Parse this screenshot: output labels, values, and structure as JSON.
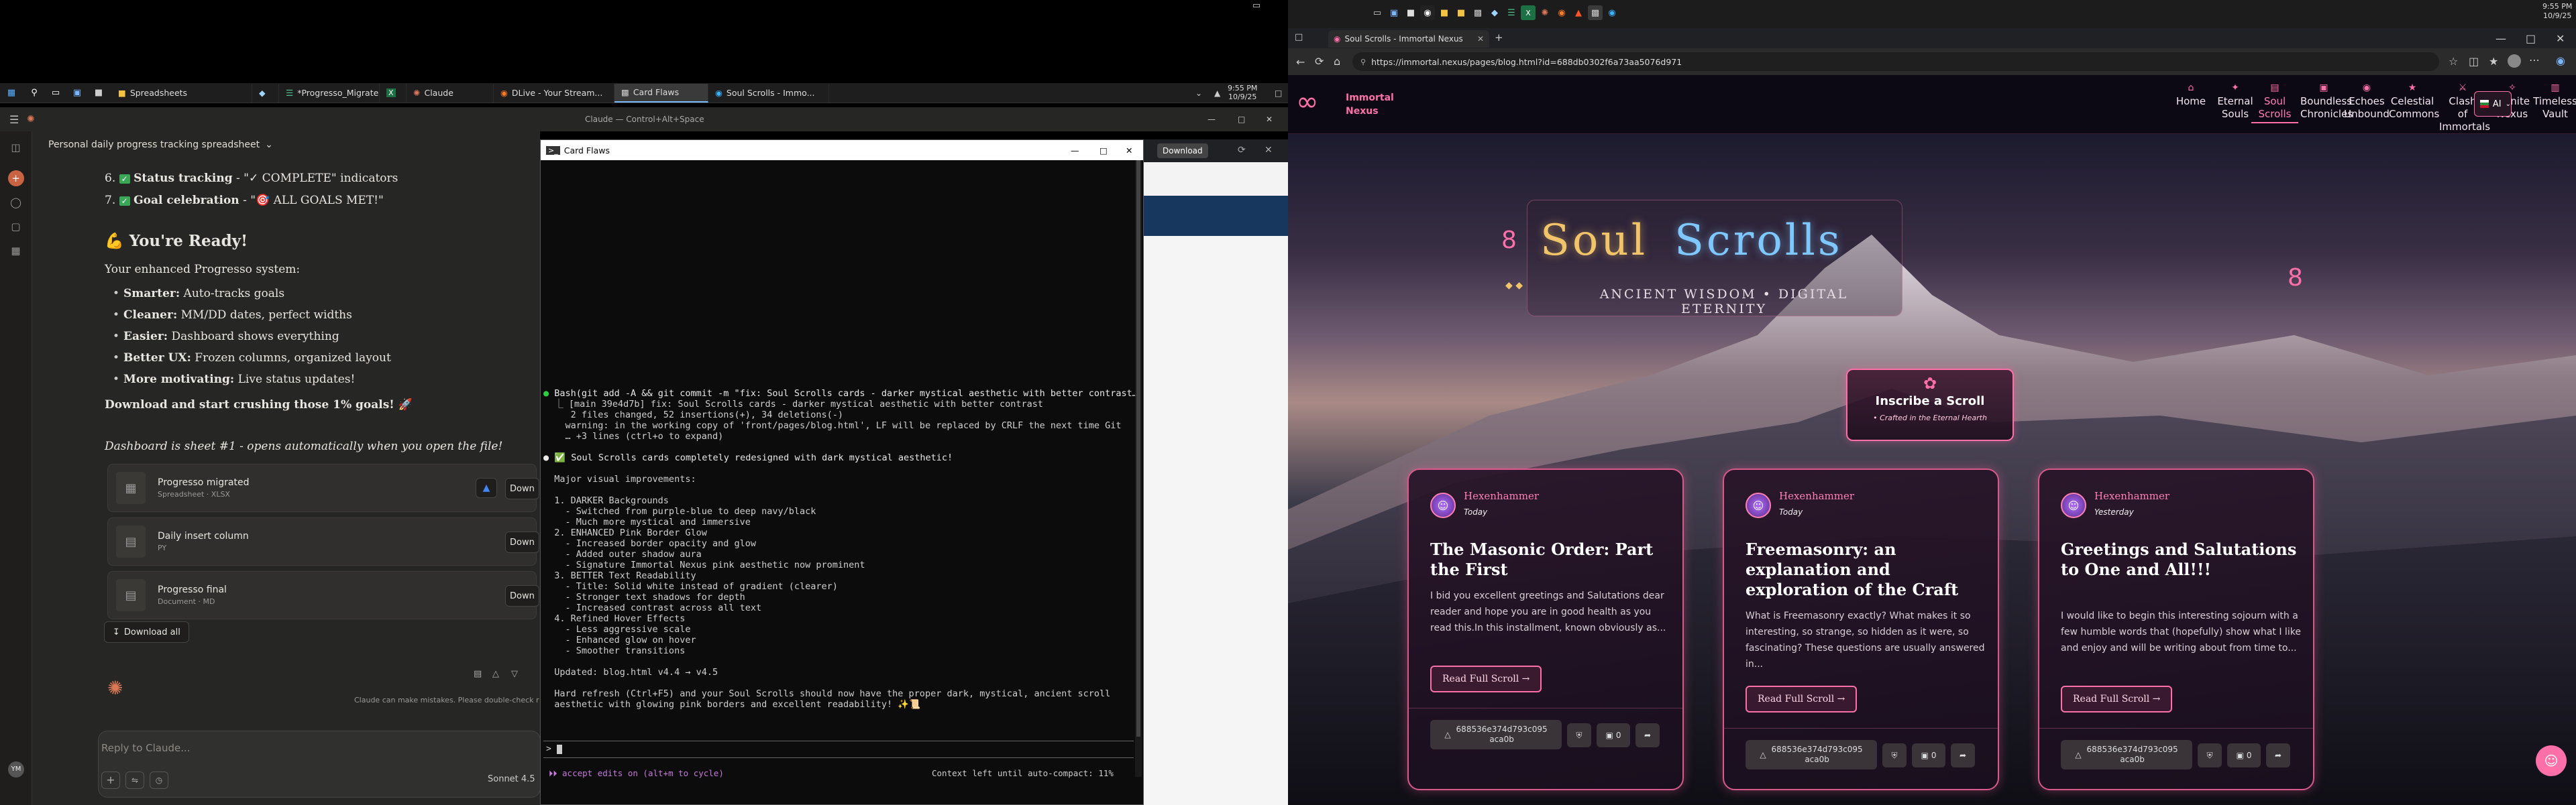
{
  "left_taskbar": {
    "clock_time": "9:55 PM",
    "clock_date": "10/9/25",
    "tabs": [
      {
        "label": "Spreadsheets"
      },
      {
        "label": "*Progresso_Migrate..."
      },
      {
        "label": "Claude"
      },
      {
        "label": "DLive - Your Stream..."
      },
      {
        "label": "Card Flaws"
      },
      {
        "label": "Soul Scrolls - Immo..."
      }
    ]
  },
  "claude": {
    "window_title": "Claude — Control+Alt+Space",
    "chat_title": "Personal daily progress tracking spreadsheet",
    "list_items": [
      {
        "num": "6.",
        "bold": "Status tracking",
        "rest": " - \"✓ COMPLETE\" indicators"
      },
      {
        "num": "7.",
        "bold": "Goal celebration",
        "rest": " - \"🎯 ALL GOALS MET!\""
      }
    ],
    "ready_heading": "💪 You're Ready!",
    "ready_intro": "Your enhanced Progresso system:",
    "bullets": [
      {
        "bold": "Smarter:",
        "rest": " Auto-tracks goals"
      },
      {
        "bold": "Cleaner:",
        "rest": " MM/DD dates, perfect widths"
      },
      {
        "bold": "Easier:",
        "rest": " Dashboard shows everything"
      },
      {
        "bold": "Better UX:",
        "rest": " Frozen columns, organized layout"
      },
      {
        "bold": "More motivating:",
        "rest": " Live status updates!"
      }
    ],
    "cta": "Download and start crushing those 1% goals! 🚀",
    "note": "Dashboard is sheet #1 - opens automatically when you open the file!",
    "files": [
      {
        "name": "Progresso migrated",
        "type": "Spreadsheet · XLSX",
        "action": "Down"
      },
      {
        "name": "Daily insert column",
        "type": "PY",
        "action": "Down"
      },
      {
        "name": "Progresso final",
        "type": "Document · MD",
        "action": "Down"
      }
    ],
    "download_all": "Download all",
    "disclaimer": "Claude can make mistakes. Please double-check r",
    "reply_placeholder": "Reply to Claude...",
    "model": "Sonnet 4.5",
    "user_initials": "YM"
  },
  "terminal": {
    "title": "Card Flaws",
    "lines": [
      {
        "t": "● Bash(git add -A && git commit -m \"fix: Soul Scrolls cards - darker mystical aesthetic with better contrast…",
        "c": "#e8e8e8",
        "dot": "#2ecc40"
      },
      {
        "t": "  ⎿ [main 39e4d7b] fix: Soul Scrolls cards - darker mystical aesthetic with better contrast",
        "c": "#cfcfcf"
      },
      {
        "t": "     2 files changed, 52 insertions(+), 34 deletions(-)",
        "c": "#cfcfcf"
      },
      {
        "t": "    warning: in the working copy of 'front/pages/blog.html', LF will be replaced by CRLF the next time Git",
        "c": "#cfcfcf"
      },
      {
        "t": "    … +3 lines (ctrl+o to expand)",
        "c": "#cfcfcf"
      },
      {
        "t": "",
        "c": "#cfcfcf"
      },
      {
        "t": "● ✅ Soul Scrolls cards completely redesigned with dark mystical aesthetic!",
        "c": "#e8e8e8",
        "dot": "#e8e8e8"
      },
      {
        "t": "",
        "c": "#cfcfcf"
      },
      {
        "t": "  Major visual improvements:",
        "c": "#cfcfcf"
      },
      {
        "t": "",
        "c": "#cfcfcf"
      },
      {
        "t": "  1. DARKER Backgrounds",
        "c": "#cfcfcf"
      },
      {
        "t": "    - Switched from purple-blue to deep navy/black",
        "c": "#cfcfcf"
      },
      {
        "t": "    - Much more mystical and immersive",
        "c": "#cfcfcf"
      },
      {
        "t": "  2. ENHANCED Pink Border Glow",
        "c": "#cfcfcf"
      },
      {
        "t": "    - Increased border opacity and glow",
        "c": "#cfcfcf"
      },
      {
        "t": "    - Added outer shadow aura",
        "c": "#cfcfcf"
      },
      {
        "t": "    - Signature Immortal Nexus pink aesthetic now prominent",
        "c": "#cfcfcf"
      },
      {
        "t": "  3. BETTER Text Readability",
        "c": "#cfcfcf"
      },
      {
        "t": "    - Title: Solid white instead of gradient (clearer)",
        "c": "#cfcfcf"
      },
      {
        "t": "    - Stronger text shadows for depth",
        "c": "#cfcfcf"
      },
      {
        "t": "    - Increased contrast across all text",
        "c": "#cfcfcf"
      },
      {
        "t": "  4. Refined Hover Effects",
        "c": "#cfcfcf"
      },
      {
        "t": "    - Less aggressive scale",
        "c": "#cfcfcf"
      },
      {
        "t": "    - Enhanced glow on hover",
        "c": "#cfcfcf"
      },
      {
        "t": "    - Smoother transitions",
        "c": "#cfcfcf"
      },
      {
        "t": "",
        "c": "#cfcfcf"
      },
      {
        "t": "  Updated: blog.html v4.4 → v4.5",
        "c": "#cfcfcf"
      },
      {
        "t": "",
        "c": "#cfcfcf"
      },
      {
        "t": "  Hard refresh (Ctrl+F5) and your Soul Scrolls should now have the proper dark, mystical, ancient scroll",
        "c": "#cfcfcf"
      },
      {
        "t": "  aesthetic with glowing pink borders and excellent readability! ✨📜",
        "c": "#cfcfcf"
      }
    ],
    "prompt": ">",
    "mode_hint": "⏵⏵ accept edits on (alt+m to cycle)",
    "context_hint": "Context left until auto-compact: 11%"
  },
  "bg_window": {
    "download_label": "Download"
  },
  "right_taskbar": {
    "clock_time": "9:55 PM",
    "clock_date": "10/9/25"
  },
  "browser": {
    "tab_title": "Soul Scrolls - Immortal Nexus",
    "url": "https://immortal.nexus/pages/blog.html?id=688db0302f6a73aa5076d971"
  },
  "site": {
    "brand_line1": "Immortal",
    "brand_line2": "Nexus",
    "nav": [
      {
        "l1": "Home",
        "l2": "",
        "icon": "⌂"
      },
      {
        "l1": "Eternal",
        "l2": "Souls",
        "icon": "✦"
      },
      {
        "l1": "Soul",
        "l2": "Scrolls",
        "icon": "▤"
      },
      {
        "l1": "Boundless",
        "l2": "Chronicles",
        "icon": "▣"
      },
      {
        "l1": "Echoes",
        "l2": "Unbound",
        "icon": "◉"
      },
      {
        "l1": "Celestial",
        "l2": "Commons",
        "icon": "★"
      },
      {
        "l1": "Clash",
        "l2": "of Immortals",
        "icon": "⚔"
      },
      {
        "l1": "Infinite",
        "l2": "Nexus",
        "icon": "✧"
      },
      {
        "l1": "Timeless",
        "l2": "Vault",
        "icon": "▥"
      }
    ],
    "lang": "AI",
    "hero_title_1": "Soul",
    "hero_title_2": "Scrolls",
    "hero_subtitle": "Ancient Wisdom • Digital Eternity",
    "inscribe_title": "Inscribe a Scroll",
    "inscribe_sub": "• Crafted in the Eternal Hearth",
    "cards": [
      {
        "author": "Hexenhammer",
        "date": "Today",
        "title": "The Masonic Order: Part the First",
        "excerpt": "I bid you excellent greetings and Salutations dear reader and hope you are in good health as you read this.In this installment, known obviously as...",
        "read": "Read Full Scroll →",
        "hash_1": "688536e374d793c095",
        "hash_2": "aca0b",
        "comments": "0"
      },
      {
        "author": "Hexenhammer",
        "date": "Today",
        "title": "Freemasonry: an explanation and exploration of the Craft",
        "excerpt": "What is Freemasonry exactly? What makes it so interesting, so strange, so hidden as it were, so fascinating? These questions are usually answered in...",
        "read": "Read Full Scroll →",
        "hash_1": "688536e374d793c095",
        "hash_2": "aca0b",
        "comments": "0"
      },
      {
        "author": "Hexenhammer",
        "date": "Yesterday",
        "title": "Greetings and Salutations to One and All!!!",
        "excerpt": "I would like to begin this interesting sojourn with a few humble words that (hopefully) show what I like and enjoy and will be writing about from time to...",
        "read": "Read Full Scroll →",
        "hash_1": "688536e374d793c095",
        "hash_2": "aca0b",
        "comments": "0"
      }
    ]
  },
  "colors": {
    "accent_pink": "#ff6fa8",
    "title_gold": "#f2c46a",
    "title_blue": "#7ec8ff"
  }
}
